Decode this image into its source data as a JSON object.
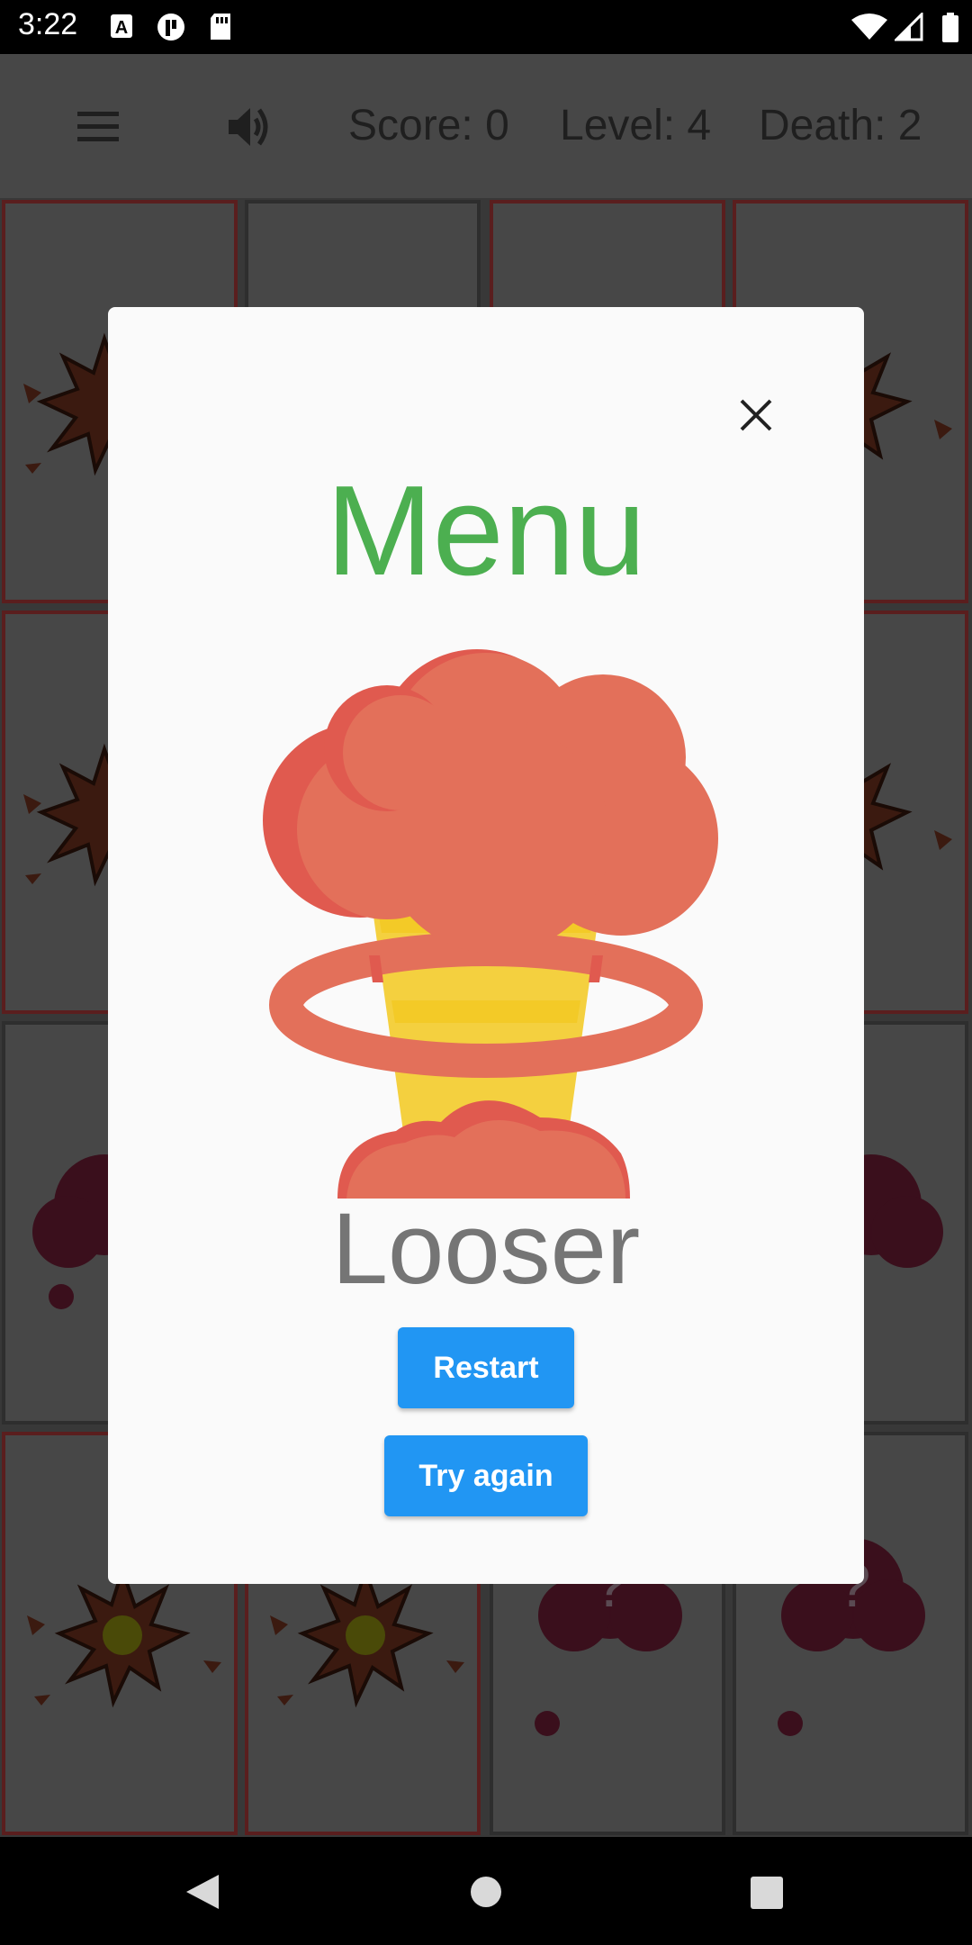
{
  "status_bar": {
    "time": "3:22",
    "icons": [
      "text-a-icon",
      "pinterest-icon",
      "sd-card-icon",
      "wifi-icon",
      "signal-icon",
      "battery-icon"
    ]
  },
  "app_bar": {
    "menu_icon": "hamburger-menu-icon",
    "sound_icon": "volume-icon",
    "score": "Score: 0",
    "level": "Level: 4",
    "death": "Death: 2"
  },
  "board": {
    "tiles": [
      "explosion",
      "unknown",
      "unknown",
      "explosion",
      "explosion",
      "unknown",
      "unknown",
      "explosion",
      "mystery",
      "unknown",
      "unknown",
      "mystery",
      "explosion",
      "explosion",
      "mystery",
      "mystery"
    ]
  },
  "dialog": {
    "title": "Menu",
    "image": "mushroom-cloud-explosion",
    "result": "Looser",
    "buttons": {
      "restart": "Restart",
      "try_again": "Try again"
    },
    "colors": {
      "title": "#4caf50",
      "button": "#2196f3",
      "result": "#757575"
    }
  },
  "nav_bar": {
    "icons": [
      "back-icon",
      "home-icon",
      "recents-icon"
    ]
  }
}
